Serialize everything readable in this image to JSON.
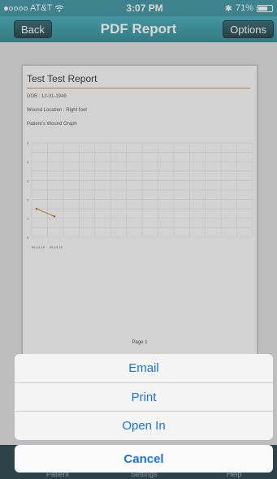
{
  "status_bar": {
    "carrier": "AT&T",
    "time": "3:07 PM",
    "battery": "71%",
    "battery_level": 0.71
  },
  "nav": {
    "back_label": "Back",
    "title": "PDF Report",
    "options_label": "Options"
  },
  "report": {
    "title": "Test Test Report",
    "dob": "DOB : 12-31-1949",
    "wound_location": "Wound Location : Right foot",
    "graph_title": "Patient's Wound Graph",
    "page_label": "Page 1"
  },
  "chart_data": {
    "type": "line",
    "categories": [
      "09-14-15",
      "09-15-15"
    ],
    "series": [
      {
        "values": [
          1.5,
          1.1
        ]
      }
    ],
    "yticks": [
      "5",
      "4",
      "3",
      "2",
      "1",
      "0"
    ],
    "ylim": [
      0,
      5
    ],
    "grid": true,
    "line_color": "#d07a25"
  },
  "tab_bar": {
    "items": [
      "Patient",
      "Settings",
      "Help"
    ]
  },
  "action_sheet": {
    "items": [
      "Email",
      "Print",
      "Open In"
    ],
    "cancel_label": "Cancel"
  },
  "colors": {
    "accent": "#1a73d8",
    "nav": "#2a8a98",
    "rule": "#b8814a"
  }
}
